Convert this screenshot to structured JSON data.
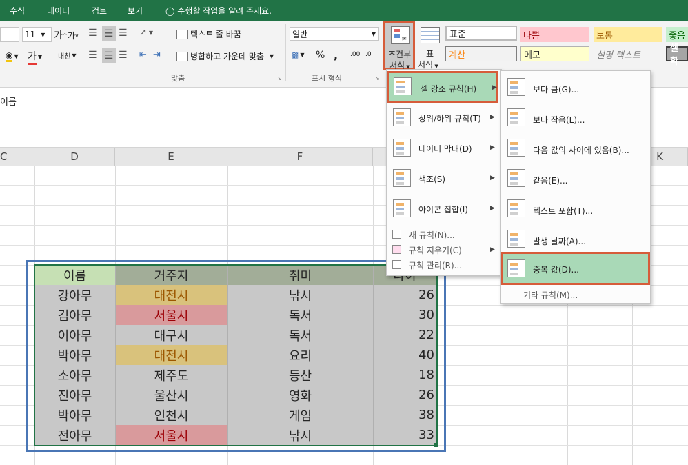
{
  "ribbon": {
    "tabs": [
      "수식",
      "데이터",
      "검토",
      "보기"
    ],
    "tell_me": "수행할 작업을 알려 주세요.",
    "font_size": "11",
    "font_grow": "가",
    "font_shrink": "가",
    "font_color_glyph": "가",
    "phonetic": "내천",
    "wrap_text": "텍스트 줄 바꿈",
    "merge_center": "병합하고 가운데 맞춤",
    "number_format": "일반",
    "percent": "%",
    "comma": ",",
    "dec_inc": ".00",
    "dec_dec": ".0",
    "group_align": "맞춤",
    "group_number": "표시 형식",
    "cond_format_line1": "조건부",
    "cond_format_line2": "서식",
    "table_format_line1": "표",
    "table_format_line2": "서식",
    "styles": {
      "normal": "표준",
      "bad": "나쁨",
      "neutral": "보통",
      "good": "좋음",
      "calc": "계산",
      "note": "메모",
      "explanatory": "설명 텍스트",
      "check": "셀 확"
    }
  },
  "formula_bar": {
    "content": "이름"
  },
  "columns": [
    "C",
    "D",
    "E",
    "F",
    "K"
  ],
  "table": {
    "headers": [
      "이름",
      "거주지",
      "취미",
      "나이"
    ],
    "rows": [
      [
        "강아무",
        "대전시",
        "낚시",
        "26"
      ],
      [
        "김아무",
        "서울시",
        "독서",
        "30"
      ],
      [
        "이아무",
        "대구시",
        "독서",
        "22"
      ],
      [
        "박아무",
        "대전시",
        "요리",
        "40"
      ],
      [
        "소아무",
        "제주도",
        "등산",
        "18"
      ],
      [
        "진아무",
        "울산시",
        "영화",
        "26"
      ],
      [
        "박아무",
        "인천시",
        "게임",
        "38"
      ],
      [
        "전아무",
        "서울시",
        "낚시",
        "33"
      ]
    ]
  },
  "cf_menu": {
    "items": [
      "셀 강조 규칙(H)",
      "상위/하위 규칙(T)",
      "데이터 막대(D)",
      "색조(S)",
      "아이콘 집합(I)"
    ],
    "plain_items": [
      "새 규칙(N)...",
      "규칙 지우기(C)",
      "규칙 관리(R)..."
    ]
  },
  "highlight_menu": {
    "items": [
      "보다 큼(G)...",
      "보다 작음(L)...",
      "다음 값의 사이에 있음(B)...",
      "같음(E)...",
      "텍스트 포함(T)...",
      "발생 날짜(A)...",
      "중복 값(D)..."
    ],
    "more": "기타 규칙(M)..."
  },
  "colors": {
    "ribbon_green": "#217346",
    "header_green": "#c6e0b4",
    "header_gray": "#a5a5a5",
    "dup_yellow": "#d9c27c",
    "dup_red": "#d99a9c",
    "menu_hover": "#a9d9b7",
    "callout": "#d65c3a",
    "table_outline": "#4a76b5"
  }
}
